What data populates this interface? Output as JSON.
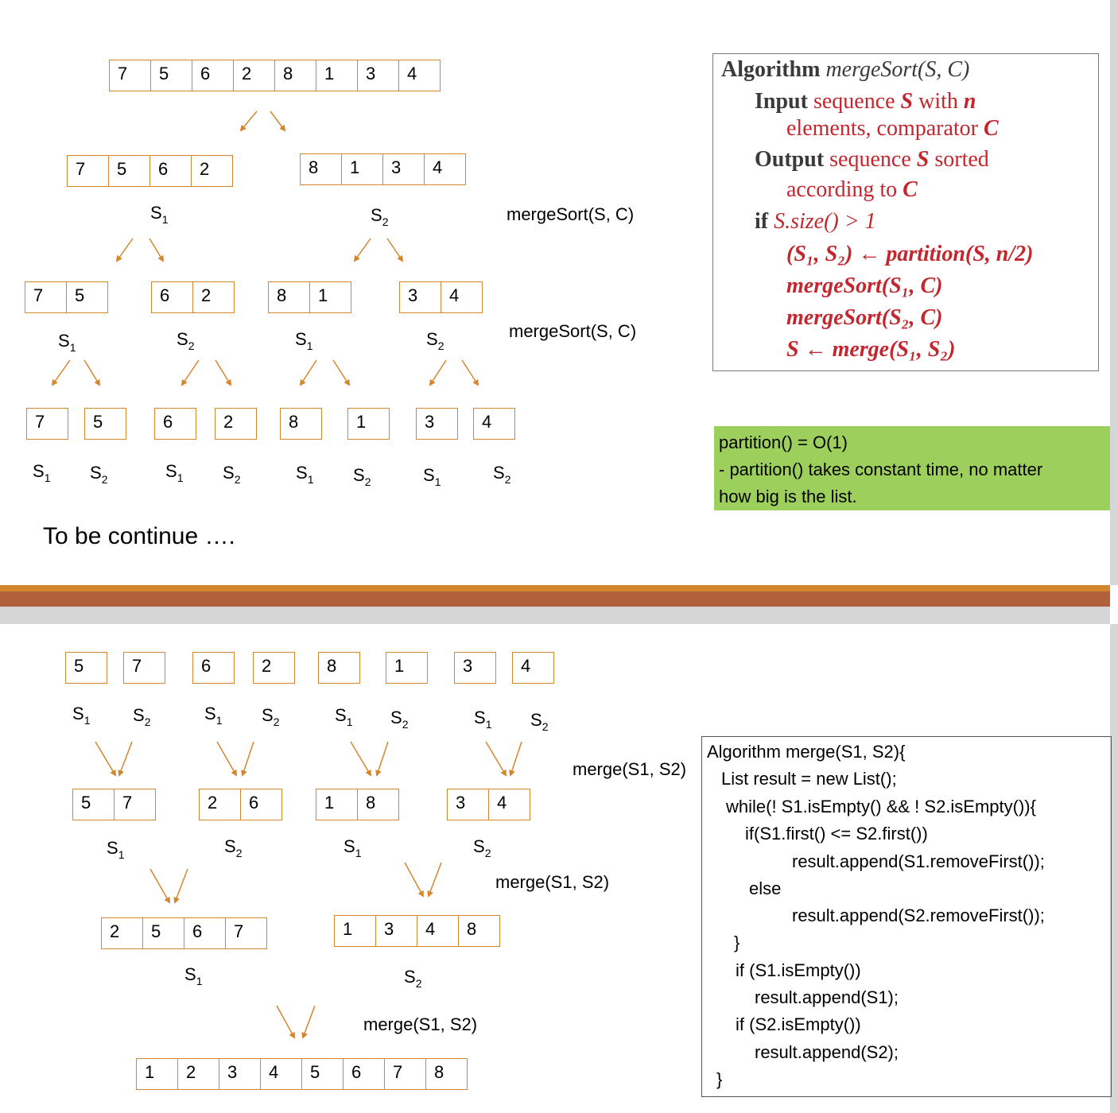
{
  "split_tree": {
    "root": [
      "7",
      "5",
      "6",
      "2",
      "8",
      "1",
      "3",
      "4"
    ],
    "level1": [
      [
        "7",
        "5",
        "6",
        "2"
      ],
      [
        "8",
        "1",
        "3",
        "4"
      ]
    ],
    "level2": [
      [
        "7",
        "5"
      ],
      [
        "6",
        "2"
      ],
      [
        "8",
        "1"
      ],
      [
        "3",
        "4"
      ]
    ],
    "level3": [
      [
        "7"
      ],
      [
        "5"
      ],
      [
        "6"
      ],
      [
        "2"
      ],
      [
        "8"
      ],
      [
        "1"
      ],
      [
        "3"
      ],
      [
        "4"
      ]
    ]
  },
  "labels": {
    "s": "S",
    "one": "1",
    "two": "2"
  },
  "calls": {
    "merge_sort": "mergeSort(S, C)",
    "merge": "merge(S1, S2)"
  },
  "continue_text": "To be continue ….",
  "algorithm": {
    "line1_kw": "Algorithm",
    "line1_name": "mergeSort(S, C)",
    "input_kw": "Input",
    "input_text1": "sequence",
    "input_s": "S",
    "input_text2": "with",
    "input_n": "n",
    "input_line2a": "elements, comparator",
    "input_c": "C",
    "output_kw": "Output",
    "output_text1": "sequence",
    "output_s": "S",
    "output_text2": "sorted",
    "output_line2a": "according to",
    "output_c": "C",
    "if_kw": "if",
    "if_cond": "S.size() > 1",
    "step1": "(S₁, S₂) ← partition(S, n/2)",
    "step2": "mergeSort(S₁, C)",
    "step3": "mergeSort(S₂, C)",
    "step4": "S ← merge(S₁, S₂)"
  },
  "note": {
    "line1": "partition() = O(1)",
    "line2": "- partition() takes constant time, no matter",
    "line3": "how big is the list."
  },
  "merge_tree": {
    "level0": [
      [
        "5"
      ],
      [
        "7"
      ],
      [
        "6"
      ],
      [
        "2"
      ],
      [
        "8"
      ],
      [
        "1"
      ],
      [
        "3"
      ],
      [
        "4"
      ]
    ],
    "level1": [
      [
        "5",
        "7"
      ],
      [
        "2",
        "6"
      ],
      [
        "1",
        "8"
      ],
      [
        "3",
        "4"
      ]
    ],
    "level2": [
      [
        "2",
        "5",
        "6",
        "7"
      ],
      [
        "1",
        "3",
        "4",
        "8"
      ]
    ],
    "level3": [
      [
        "1",
        "2",
        "3",
        "4",
        "5",
        "6",
        "7",
        "8"
      ]
    ]
  },
  "code": [
    "Algorithm merge(S1, S2){",
    "List result = new List();",
    "while(! S1.isEmpty() && ! S2.isEmpty()){",
    "if(S1.first() <= S2.first())",
    "result.append(S1.removeFirst());",
    "else",
    "result.append(S2.removeFirst());",
    "}",
    "if (S1.isEmpty())",
    "result.append(S1);",
    "if (S2.isEmpty())",
    "result.append(S2);",
    "}"
  ],
  "colors": {
    "accent_orange": "#d4862c",
    "divider_brown": "#b2603a",
    "note_green": "#9ccf5b",
    "algo_red": "#c4262e"
  }
}
